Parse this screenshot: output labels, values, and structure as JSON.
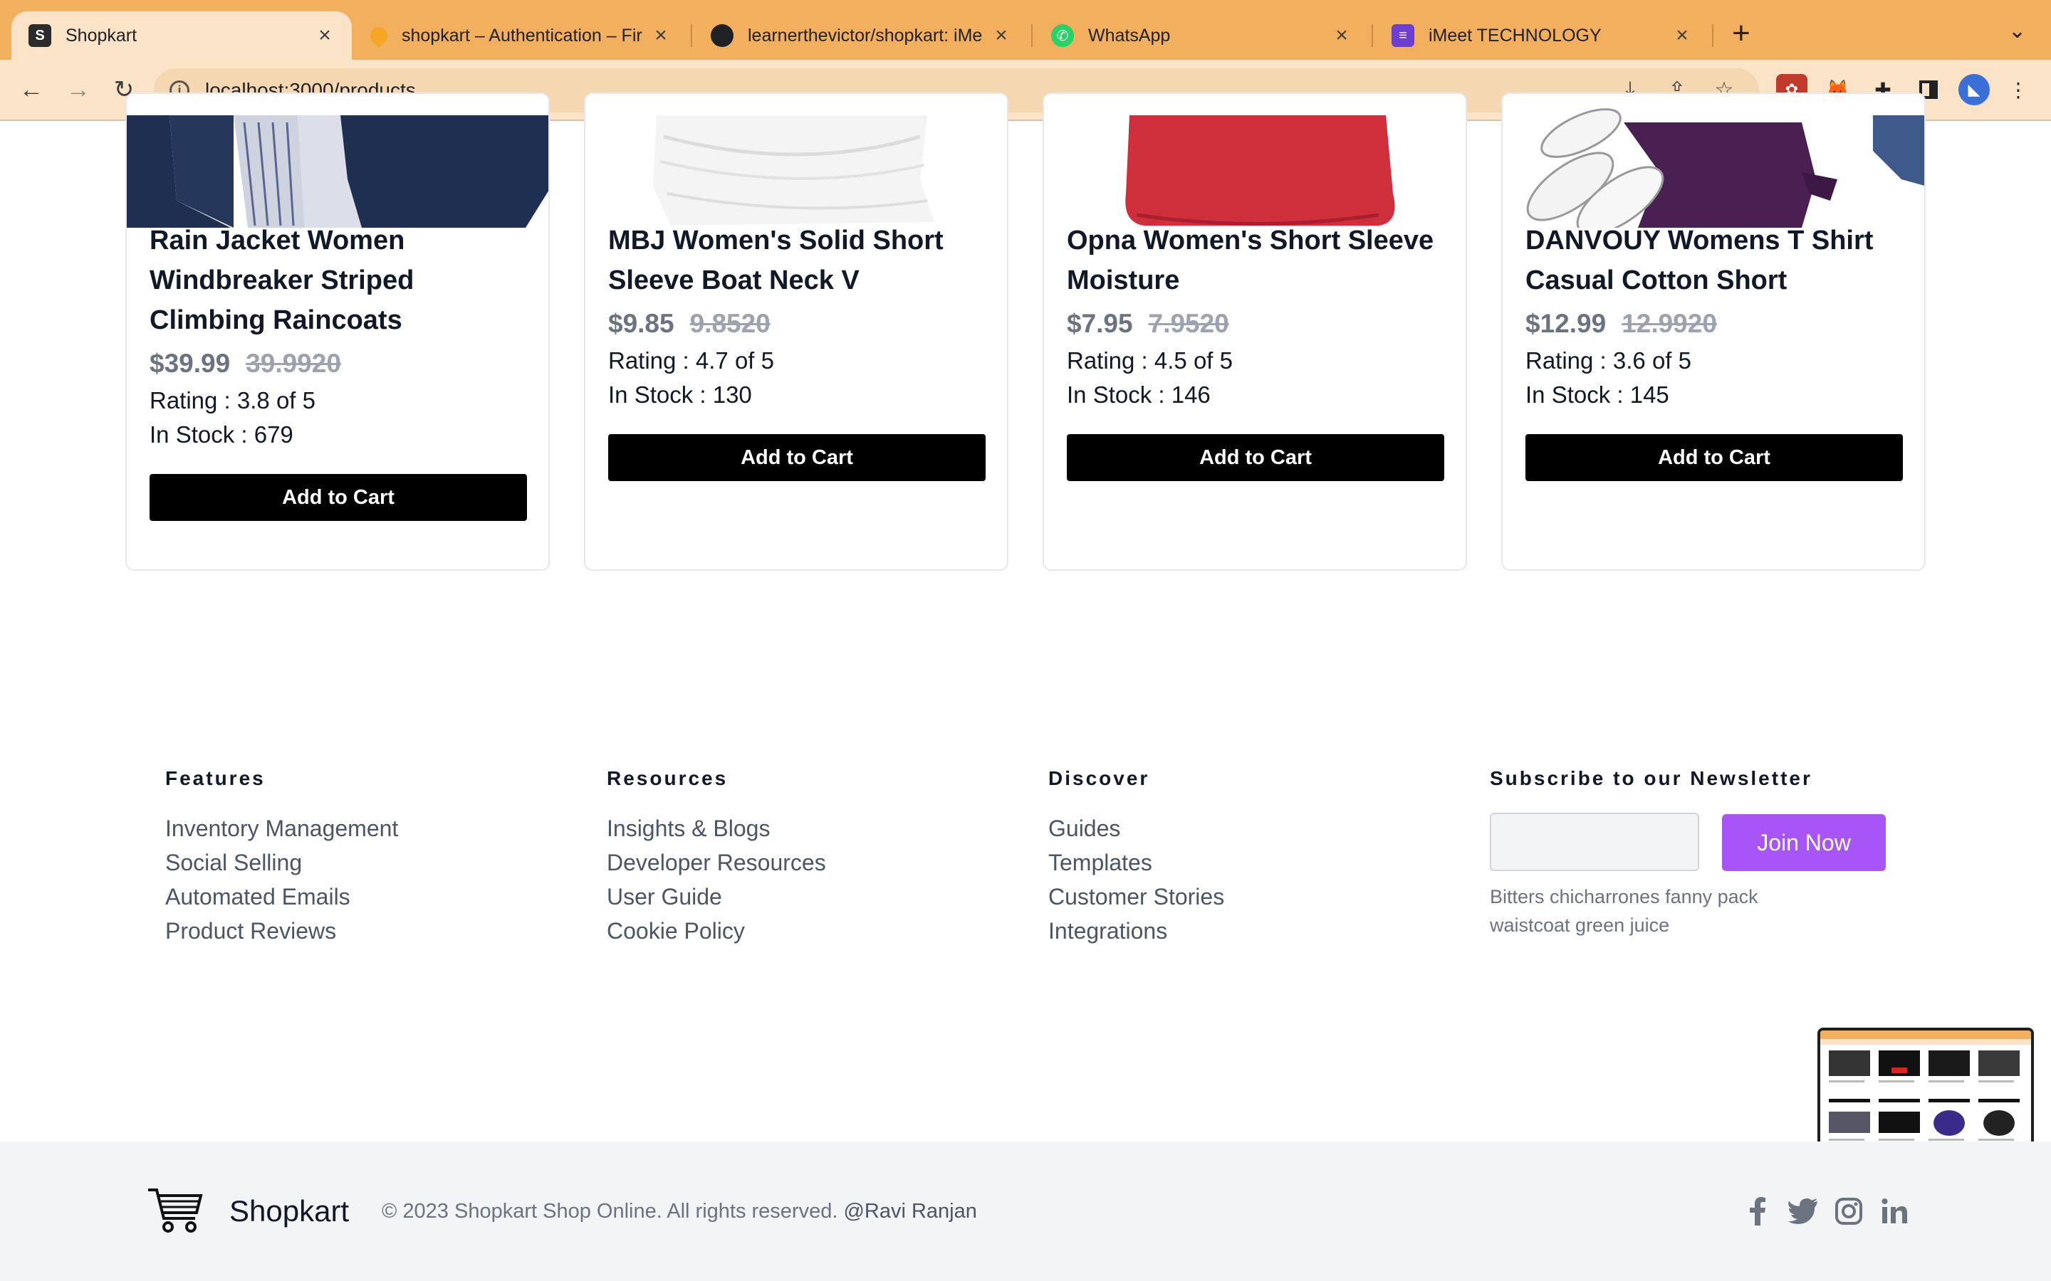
{
  "browser": {
    "tabs": [
      {
        "title": "Shopkart",
        "active": true
      },
      {
        "title": "shopkart – Authentication – Fir"
      },
      {
        "title": "learnerthevictor/shopkart: iMe"
      },
      {
        "title": "WhatsApp"
      },
      {
        "title": "iMeet TECHNOLOGY"
      }
    ],
    "url": "localhost:3000/products"
  },
  "products": [
    {
      "name": "Rain Jacket Women Windbreaker Striped Climbing Raincoats",
      "price": "$39.99",
      "old_price": "39.9920",
      "rating": "Rating : 3.8 of 5",
      "stock": "In Stock : 679",
      "button": "Add to Cart"
    },
    {
      "name": "MBJ Women's Solid Short Sleeve Boat Neck V",
      "price": "$9.85",
      "old_price": "9.8520",
      "rating": "Rating : 4.7 of 5",
      "stock": "In Stock : 130",
      "button": "Add to Cart"
    },
    {
      "name": "Opna Women's Short Sleeve Moisture",
      "price": "$7.95",
      "old_price": "7.9520",
      "rating": "Rating : 4.5 of 5",
      "stock": "In Stock : 146",
      "button": "Add to Cart"
    },
    {
      "name": "DANVOUY Womens T Shirt Casual Cotton Short",
      "price": "$12.99",
      "old_price": "12.9920",
      "rating": "Rating : 3.6 of 5",
      "stock": "In Stock : 145",
      "button": "Add to Cart"
    }
  ],
  "footer": {
    "columns": [
      {
        "heading": "Features",
        "links": [
          "Inventory Management",
          "Social Selling",
          "Automated Emails",
          "Product Reviews"
        ]
      },
      {
        "heading": "Resources",
        "links": [
          "Insights & Blogs",
          "Developer Resources",
          "User Guide",
          "Cookie Policy"
        ]
      },
      {
        "heading": "Discover",
        "links": [
          "Guides",
          "Templates",
          "Customer Stories",
          "Integrations"
        ]
      }
    ],
    "newsletter": {
      "heading": "Subscribe to our Newsletter",
      "button": "Join Now",
      "note": "Bitters chicharrones fanny pack waistcoat green juice"
    },
    "brand": "Shopkart",
    "copyright": "© 2023 Shopkart Shop Online. All rights reserved.",
    "author": "@Ravi Ranjan",
    "social_icons": [
      "facebook-icon",
      "twitter-icon",
      "instagram-icon",
      "linkedin-icon"
    ]
  },
  "colors": {
    "tabstrip": "#f2b05e",
    "toolbar": "#fbe3c8",
    "accent": "#a855f7"
  }
}
